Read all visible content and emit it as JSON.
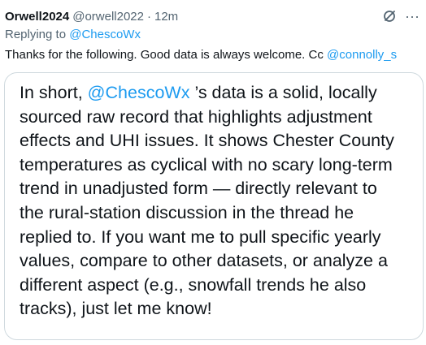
{
  "tweet": {
    "author_name": "Orwell2024",
    "handle": "@orwell2022",
    "separator": "·",
    "time": "12m",
    "replying_label": "Replying to",
    "replying_to": "@ChescoWx",
    "text": "Thanks for the following. Good data is always welcome. Cc",
    "text_mention": "@connolly_s",
    "icons": {
      "grok": "grok-icon",
      "more": "more-options-icon"
    },
    "colors": {
      "link": "#1d9bf0",
      "secondary_text": "#536471",
      "primary_text": "#0f1419",
      "border": "#cfd9de"
    }
  },
  "quote": {
    "prefix": "In short,",
    "mention": "@ChescoWx",
    "text": "’s data is a solid, locally sourced raw record that highlights adjustment effects and UHI issues. It shows Chester County temperatures as cyclical with no scary long-term trend in unadjusted form — directly relevant to the rural-station discussion in the thread he replied to. If you want me to pull specific yearly values, compare to other datasets, or analyze a different aspect (e.g., snowfall trends he also tracks), just let me know!"
  }
}
